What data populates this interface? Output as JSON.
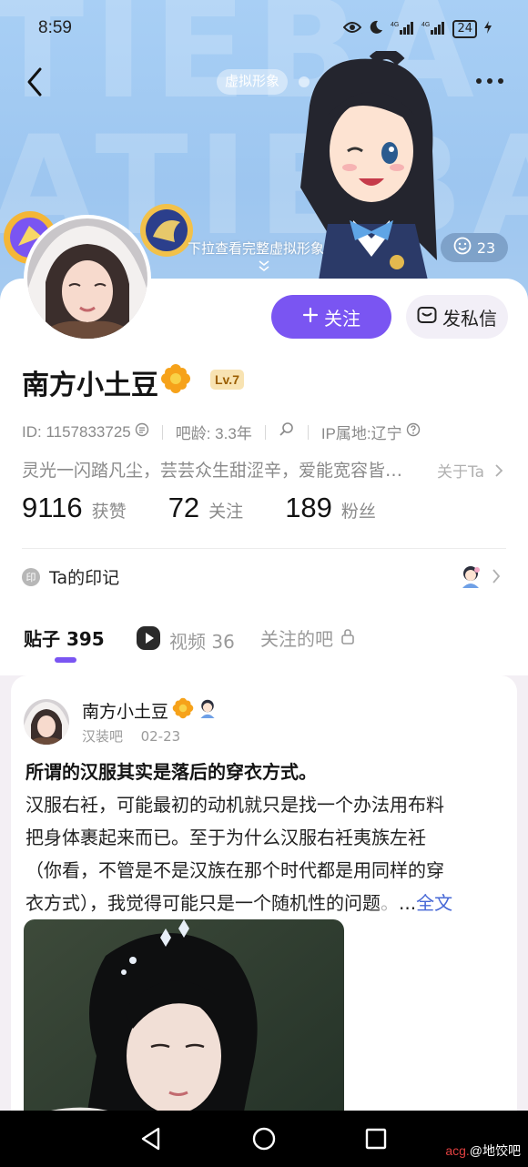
{
  "status_bar": {
    "time": "8:59",
    "battery": "24",
    "net1": "4G",
    "net2": "4G"
  },
  "header": {
    "avatar_pill": "虚拟形象",
    "pull_hint": "下拉查看完整虚拟形象",
    "like_count": "23"
  },
  "profile": {
    "name": "南方小土豆",
    "level": "Lv.7",
    "follow_label": "关注",
    "message_label": "发私信",
    "id_text": "ID: 1157833725",
    "tieba_age": "吧龄: 3.3年",
    "ip_location": "IP属地:辽宁",
    "bio": "灵光一闪踏凡尘，芸芸众生甜涩辛，爱能宽容皆…",
    "about_label": "关于Ta",
    "stats": [
      {
        "value": "9116",
        "label": "获赞"
      },
      {
        "value": "72",
        "label": "关注"
      },
      {
        "value": "189",
        "label": "粉丝"
      }
    ],
    "imprint_label": "Ta的印记",
    "imprint_badge": "印"
  },
  "tabs": [
    {
      "label": "贴子 395",
      "active": true
    },
    {
      "label": "视频 36",
      "active": false
    },
    {
      "label": "关注的吧",
      "active": false
    }
  ],
  "post": {
    "author": "南方小土豆",
    "forum": "汉装吧",
    "date": "02-23",
    "title": "所谓的汉服其实是落后的穿衣方式。",
    "body_lines": [
      "汉服右衽，可能最初的动机就只是找一个办法用布料",
      "把身体裹起来而已。至于为什么汉服右衽夷族左衽",
      "（你看，不管是不是汉族在那个时代都是用同样的穿"
    ],
    "body_last": "衣方式），我觉得可能只是一个随机性的问题",
    "body_fade": "。",
    "ellipsis": "...",
    "full_label": "全文"
  },
  "watermark": {
    "prefix": "acg.",
    "domain": "@地饺吧"
  },
  "colors": {
    "accent": "#7a55f2",
    "level_bg": "#f8e3b2",
    "link": "#4768d6"
  }
}
